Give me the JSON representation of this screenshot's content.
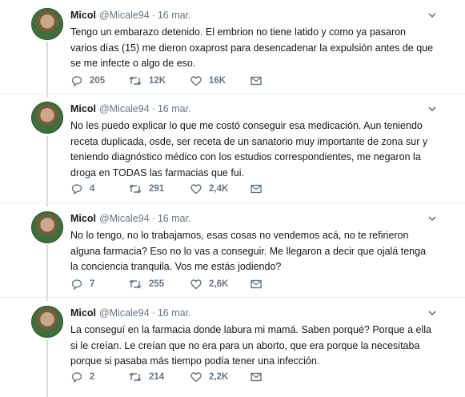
{
  "tweets": [
    {
      "name": "Micol",
      "handle": "@Micale94",
      "dot": "·",
      "date": "16 mar.",
      "lines": [
        "Tengo un embarazo detenido. El embrion no tiene latido y como ya pasaron",
        "varios días (15) me dieron oxaprost para desencadenar la expulsión antes de que",
        "se me infecte o algo de eso."
      ],
      "replies": "205",
      "retweets": "12K",
      "likes": "16K"
    },
    {
      "name": "Micol",
      "handle": "@Micale94",
      "dot": "·",
      "date": "16 mar.",
      "lines": [
        "No les puedo explicar lo que me costó conseguir esa medicación. Aun teniendo",
        "receta duplicada, osde, ser receta de un sanatorio muy importante de zona sur y",
        "teniendo diagnóstico médico con los estudios correspondientes, me negaron la",
        "droga en TODAS las farmacias que fui."
      ],
      "replies": "4",
      "retweets": "291",
      "likes": "2,4K"
    },
    {
      "name": "Micol",
      "handle": "@Micale94",
      "dot": "·",
      "date": "16 mar.",
      "lines": [
        "No lo tengo, no lo trabajamos, esas cosas no vendemos acá, no te refirieron",
        "alguna farmacia? Eso no lo vas a conseguir. Me llegaron a decir que ojalá tenga",
        "la conciencia tranquila. Vos me estás jodiendo?"
      ],
      "replies": "7",
      "retweets": "255",
      "likes": "2,6K"
    },
    {
      "name": "Micol",
      "handle": "@Micale94",
      "dot": "·",
      "date": "16 mar.",
      "lines": [
        "La conseguí en la farmacia donde labura mi mamá. Saben porqué? Porque a ella",
        "si le creían. Le creían que no era para un aborto, que era porque la necesitaba",
        "porque si pasaba más tiempo podía tener una infección."
      ],
      "replies": "2",
      "retweets": "214",
      "likes": "2,2K"
    }
  ]
}
